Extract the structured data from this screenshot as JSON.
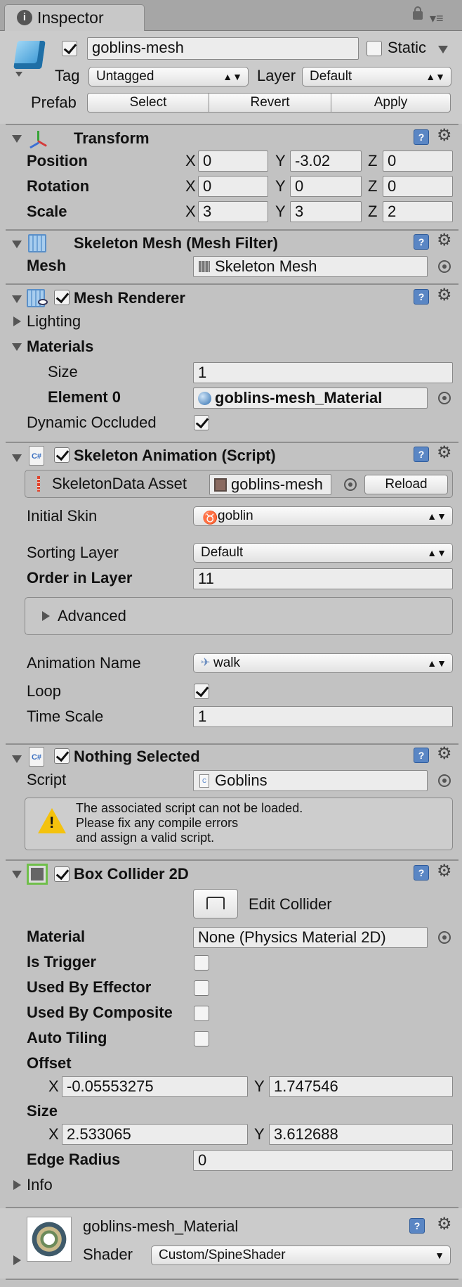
{
  "tab": {
    "title": "Inspector"
  },
  "object": {
    "name": "goblins-mesh",
    "static_label": "Static",
    "tag_label": "Tag",
    "tag_value": "Untagged",
    "layer_label": "Layer",
    "layer_value": "Default",
    "prefab_label": "Prefab",
    "prefab_buttons": [
      "Select",
      "Revert",
      "Apply"
    ]
  },
  "transform": {
    "title": "Transform",
    "rows": [
      {
        "label": "Position",
        "x": "0",
        "y": "-3.02",
        "z": "0"
      },
      {
        "label": "Rotation",
        "x": "0",
        "y": "0",
        "z": "0"
      },
      {
        "label": "Scale",
        "x": "3",
        "y": "3",
        "z": "2"
      }
    ],
    "axis": {
      "x": "X",
      "y": "Y",
      "z": "Z"
    }
  },
  "mesh_filter": {
    "title": "Skeleton Mesh (Mesh Filter)",
    "mesh_label": "Mesh",
    "mesh_value": "Skeleton Mesh"
  },
  "mesh_renderer": {
    "title": "Mesh Renderer",
    "lighting": "Lighting",
    "materials": "Materials",
    "size_label": "Size",
    "size_value": "1",
    "element_label": "Element 0",
    "element_value": "goblins-mesh_Material",
    "dynamic_label": "Dynamic Occluded"
  },
  "skeleton_animation": {
    "title": "Skeleton Animation (Script)",
    "data_asset_label": "SkeletonData Asset",
    "data_asset_value": "goblins-mesh",
    "reload": "Reload",
    "initial_skin_label": "Initial Skin",
    "initial_skin_value": "goblin",
    "sorting_layer_label": "Sorting Layer",
    "sorting_layer_value": "Default",
    "order_label": "Order in Layer",
    "order_value": "11",
    "advanced": "Advanced",
    "anim_name_label": "Animation Name",
    "anim_name_value": "walk",
    "loop_label": "Loop",
    "time_scale_label": "Time Scale",
    "time_scale_value": "1"
  },
  "nothing_selected": {
    "title": "Nothing Selected",
    "script_label": "Script",
    "script_value": "Goblins",
    "warning_lines": [
      "The associated script can not be loaded.",
      "Please fix any compile errors",
      "and assign a valid script."
    ]
  },
  "box_collider": {
    "title": "Box Collider 2D",
    "edit_collider": "Edit Collider",
    "material_label": "Material",
    "material_value": "None (Physics Material 2D)",
    "is_trigger": "Is Trigger",
    "used_by_effector": "Used By Effector",
    "used_by_composite": "Used By Composite",
    "auto_tiling": "Auto Tiling",
    "offset_label": "Offset",
    "offset_x": "-0.05553275",
    "offset_y": "1.747546",
    "size_label": "Size",
    "size_x": "2.533065",
    "size_y": "3.612688",
    "edge_radius_label": "Edge Radius",
    "edge_radius_value": "0",
    "info": "Info",
    "x": "X",
    "y": "Y"
  },
  "material": {
    "name": "goblins-mesh_Material",
    "shader_label": "Shader",
    "shader_value": "Custom/SpineShader"
  }
}
